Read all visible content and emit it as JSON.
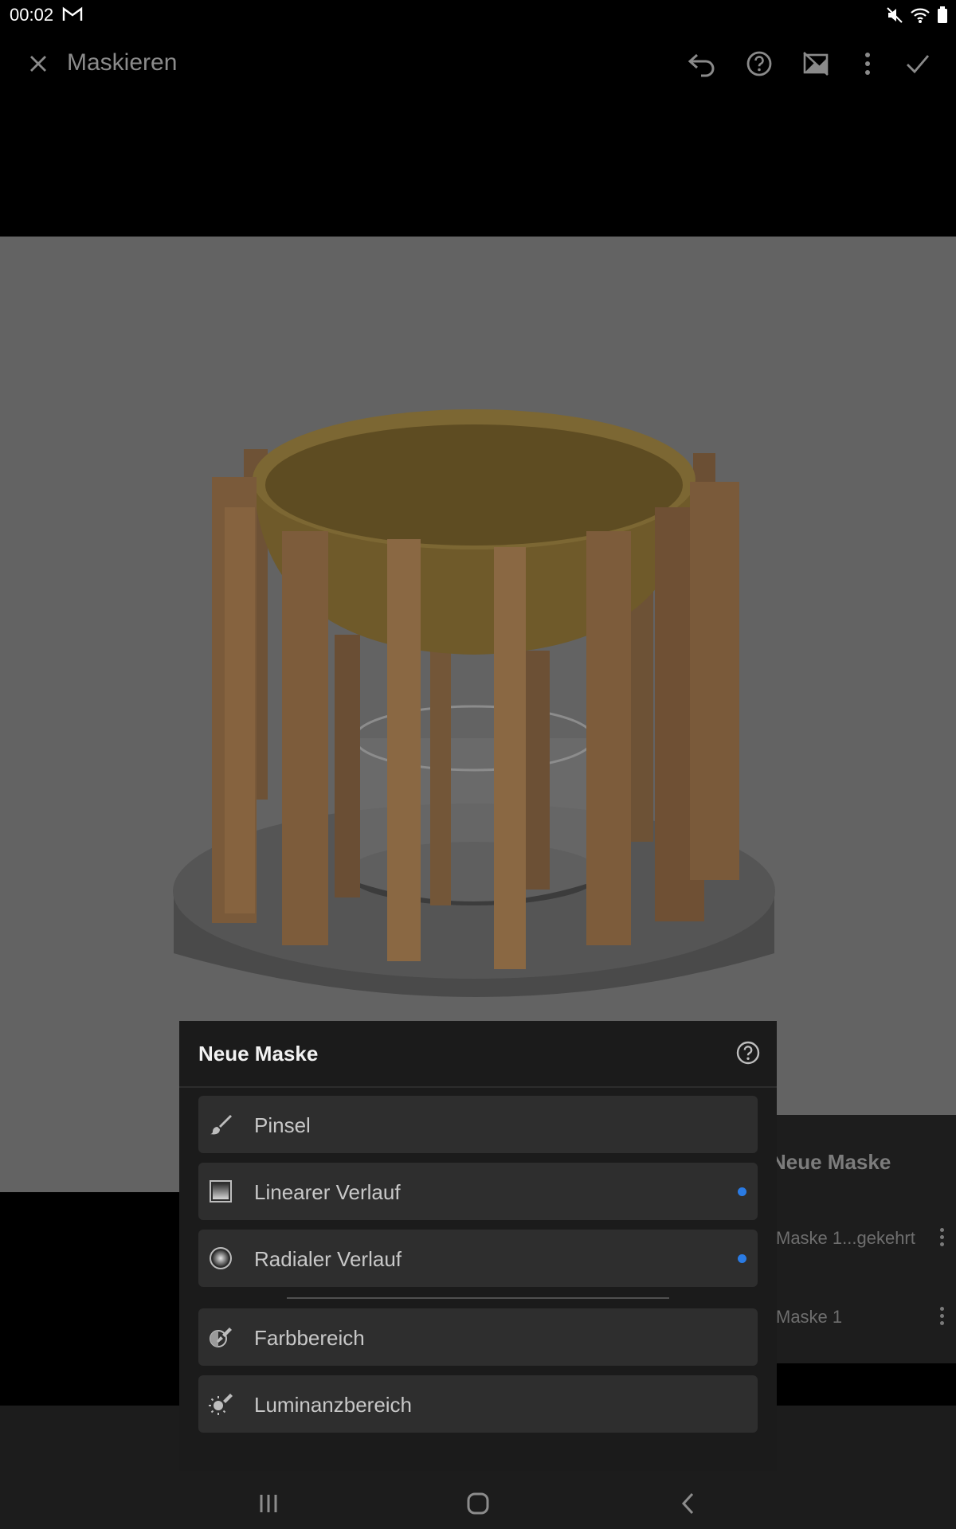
{
  "status_bar": {
    "time": "00:02",
    "icons": [
      "gmail-icon",
      "mute-icon",
      "wifi-icon",
      "battery-icon"
    ]
  },
  "top_bar": {
    "title": "Maskieren",
    "icons": [
      "close-icon",
      "undo-icon",
      "help-icon",
      "mask-overlay-toggle-icon",
      "more-vert-icon",
      "check-icon"
    ]
  },
  "mask_sheet": {
    "title": "Neue Maske",
    "options": [
      {
        "label": "Pinsel",
        "icon": "brush-icon",
        "dot": false
      },
      {
        "label": "Linearer Verlauf",
        "icon": "linear-gradient-icon",
        "dot": true
      },
      {
        "label": "Radialer Verlauf",
        "icon": "radial-gradient-icon",
        "dot": true
      },
      {
        "label": "Farbbereich",
        "icon": "color-range-icon",
        "dot": false
      },
      {
        "label": "Luminanzbereich",
        "icon": "luminance-range-icon",
        "dot": false
      }
    ]
  },
  "mask_panel": {
    "title": "Neue Maske",
    "items": [
      "Maske 1...gekehrt",
      "Maske 1"
    ]
  },
  "colors": {
    "accent_dot": "#2a7be4",
    "sheet_bg": "#1b1b1b",
    "option_bg": "#2e2e2e",
    "photo_bg": "#636363"
  }
}
